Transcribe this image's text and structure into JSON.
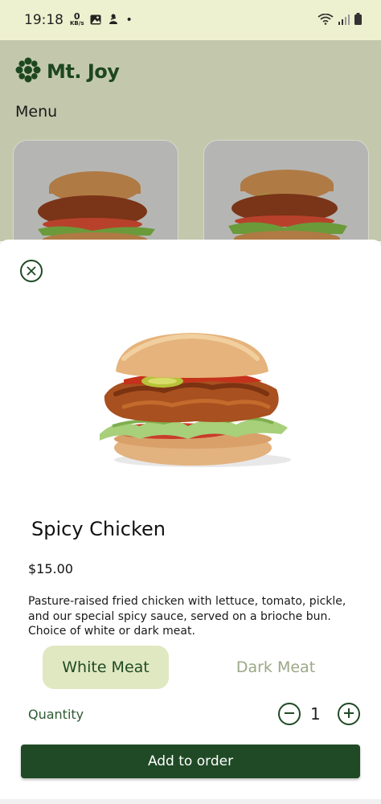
{
  "status_bar": {
    "time": "19:18",
    "net_speed_value": "0",
    "net_speed_unit": "KB/s",
    "dot": "•"
  },
  "app": {
    "brand": "Mt. Joy",
    "menu_heading": "Menu"
  },
  "sheet": {
    "title": "Spicy Chicken",
    "price": "$15.00",
    "description": "Pasture-raised fried chicken with lettuce, tomato, pickle, and our special spicy sauce, served on a brioche bun. Choice of white or dark meat.",
    "options": {
      "selected": "White Meat",
      "unselected": "Dark Meat"
    },
    "quantity_label": "Quantity",
    "quantity_value": "1",
    "add_button": "Add to order"
  },
  "colors": {
    "brand_green": "#1f4a24",
    "selected_option_bg": "#e0e8c2",
    "status_bg": "#eef1cf"
  },
  "icons": [
    "close-icon",
    "minus-circle-icon",
    "plus-circle-icon",
    "brand-flower-icon",
    "wifi-icon",
    "signal-icon",
    "battery-icon",
    "gallery-icon"
  ]
}
